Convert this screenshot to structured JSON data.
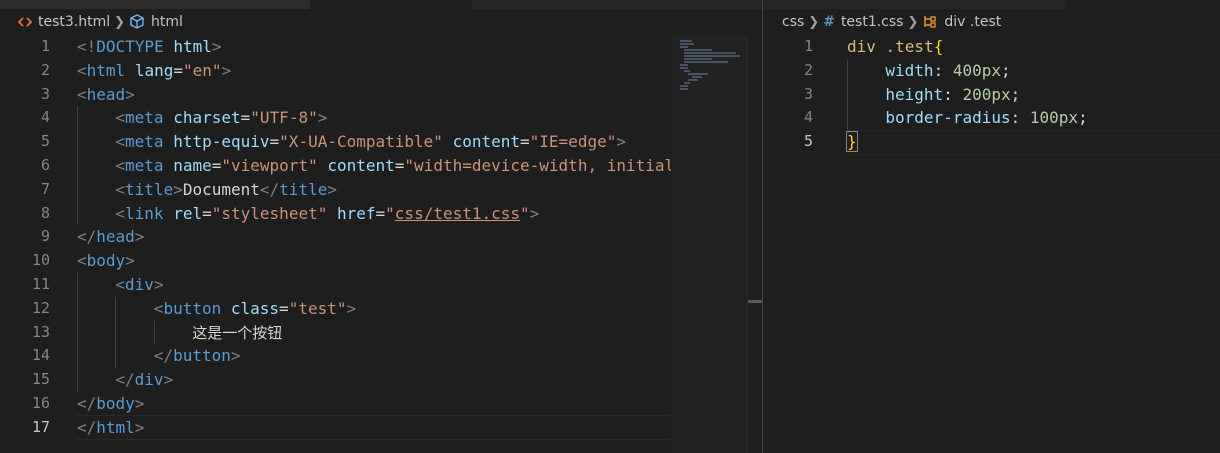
{
  "left_editor": {
    "breadcrumb": {
      "file": "test3.html",
      "symbol": "html"
    },
    "line_numbers": [
      "1",
      "2",
      "3",
      "4",
      "5",
      "6",
      "7",
      "8",
      "9",
      "10",
      "11",
      "12",
      "13",
      "14",
      "15",
      "16",
      "17"
    ],
    "code": {
      "l1": [
        "<!",
        "DOCTYPE",
        " ",
        "html",
        ">"
      ],
      "l2": [
        "<",
        "html",
        " ",
        "lang",
        "=",
        "\"en\"",
        ">"
      ],
      "l3": [
        "<",
        "head",
        ">"
      ],
      "l4": [
        "<",
        "meta",
        " ",
        "charset",
        "=",
        "\"UTF-8\"",
        ">"
      ],
      "l5": [
        "<",
        "meta",
        " ",
        "http-equiv",
        "=",
        "\"X-UA-Compatible\"",
        " ",
        "content",
        "=",
        "\"IE=edge\"",
        ">"
      ],
      "l6": [
        "<",
        "meta",
        " ",
        "name",
        "=",
        "\"viewport\"",
        " ",
        "content",
        "=",
        "\"width=device-width, initial"
      ],
      "l7": [
        "<",
        "title",
        ">",
        "Document",
        "</",
        "title",
        ">"
      ],
      "l8": [
        "<",
        "link",
        " ",
        "rel",
        "=",
        "\"stylesheet\"",
        " ",
        "href",
        "=",
        "\"",
        "css/test1.css",
        "\"",
        ">"
      ],
      "l9": [
        "</",
        "head",
        ">"
      ],
      "l10": [
        "<",
        "body",
        ">"
      ],
      "l11": [
        "<",
        "div",
        ">"
      ],
      "l12": [
        "<",
        "button",
        " ",
        "class",
        "=",
        "\"test\"",
        ">"
      ],
      "l13": [
        "这是一个按钮"
      ],
      "l14": [
        "</",
        "button",
        ">"
      ],
      "l15": [
        "</",
        "div",
        ">"
      ],
      "l16": [
        "</",
        "body",
        ">"
      ],
      "l17": [
        "</",
        "html",
        ">"
      ]
    }
  },
  "right_editor": {
    "breadcrumb": {
      "folder": "css",
      "file": "test1.css",
      "symbol": "div .test"
    },
    "line_numbers": [
      "1",
      "2",
      "3",
      "4",
      "5"
    ],
    "code": {
      "l1": [
        "div .test",
        "{"
      ],
      "l2": [
        "width",
        ": ",
        "400px",
        ";"
      ],
      "l3": [
        "height",
        ": ",
        "200px",
        ";"
      ],
      "l4": [
        "border-radius",
        ": ",
        "100px",
        ";"
      ],
      "l5": [
        "}"
      ]
    }
  },
  "colors": {
    "background": "#1e1e1e",
    "tag": "#569cd6",
    "attribute": "#9cdcfe",
    "string": "#ce9178",
    "selector": "#d7ba7d",
    "number": "#b5cea8",
    "bracket": "#ffd700"
  }
}
